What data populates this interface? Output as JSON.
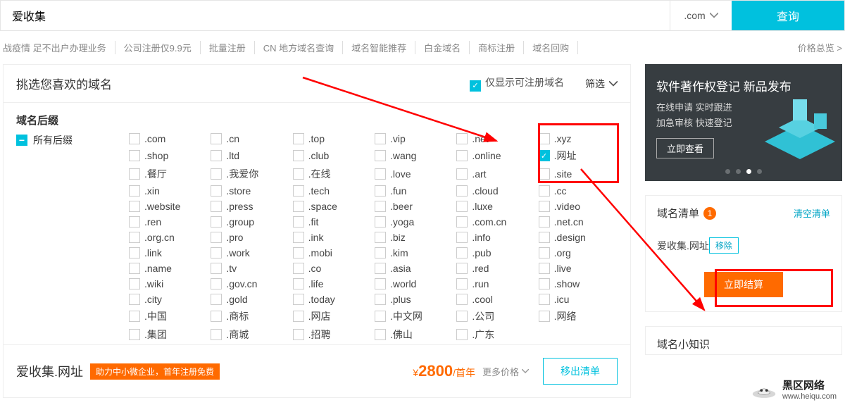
{
  "search": {
    "value": "爱收集",
    "tld": ".com",
    "button": "查询"
  },
  "nav": {
    "items": [
      "战疫情 足不出户办理业务",
      "公司注册仅9.9元",
      "批量注册",
      "CN 地方域名查询",
      "域名智能推荐",
      "白金域名",
      "商标注册",
      "域名回购"
    ],
    "price_overview": "价格总览 >"
  },
  "pick": {
    "title": "挑选您喜欢的域名",
    "only_reg": "仅显示可注册域名",
    "filter": "筛选"
  },
  "suffix": {
    "title": "域名后缀",
    "all": "所有后缀",
    "grid": [
      [
        ".com",
        ".cn",
        ".top",
        ".vip",
        ".net",
        ".xyz"
      ],
      [
        ".shop",
        ".ltd",
        ".club",
        ".wang",
        ".online",
        ".网址"
      ],
      [
        ".餐厅",
        ".我爱你",
        ".在线",
        ".love",
        ".art",
        ".site"
      ],
      [
        ".xin",
        ".store",
        ".tech",
        ".fun",
        ".cloud",
        ".cc"
      ],
      [
        ".website",
        ".press",
        ".space",
        ".beer",
        ".luxe",
        ".video"
      ],
      [
        ".ren",
        ".group",
        ".fit",
        ".yoga",
        ".com.cn",
        ".net.cn"
      ],
      [
        ".org.cn",
        ".pro",
        ".ink",
        ".biz",
        ".info",
        ".design"
      ],
      [
        ".link",
        ".work",
        ".mobi",
        ".kim",
        ".pub",
        ".org"
      ],
      [
        ".name",
        ".tv",
        ".co",
        ".asia",
        ".red",
        ".live"
      ],
      [
        ".wiki",
        ".gov.cn",
        ".life",
        ".world",
        ".run",
        ".show"
      ],
      [
        ".city",
        ".gold",
        ".today",
        ".plus",
        ".cool",
        ".icu"
      ],
      [
        ".中国",
        ".商标",
        ".网店",
        ".中文网",
        ".公司",
        ".网络"
      ],
      [
        ".集团",
        ".商城",
        ".招聘",
        ".佛山",
        ".广东",
        ""
      ]
    ],
    "checked": [
      ".网址"
    ]
  },
  "result": {
    "name": "爱收集.网址",
    "badge": "助力中小微企业，首年注册免费",
    "price_num": "2800",
    "price_unit": "/首年",
    "more": "更多价格",
    "remove": "移出清单"
  },
  "promo": {
    "title": "软件著作权登记 新品发布",
    "line1": "在线申请 实时跟进",
    "line2": "加急审核 快速登记",
    "cta": "立即查看"
  },
  "cart": {
    "title": "域名清单",
    "count": "1",
    "clear": "清空清单",
    "item_name": "爱收集.网址",
    "item_remove": "移除",
    "checkout": "立即结算"
  },
  "tips": {
    "title": "域名小知识"
  },
  "watermark": {
    "text": "黑区网络",
    "url": "www.heiqu.com"
  }
}
